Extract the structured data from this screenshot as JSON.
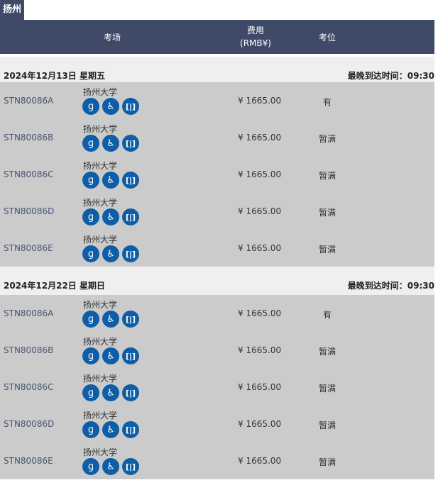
{
  "city_tab": "扬州",
  "header": {
    "venue": "考场",
    "fee_line1": "费用",
    "fee_line2": "(RMB¥)",
    "seat": "考位"
  },
  "icons": [
    "hearing-aid-icon",
    "wheelchair-icon",
    "accessible-door-icon"
  ],
  "colors": {
    "header_bg": "#3f4a68",
    "row_bg": "#cbcbcb",
    "date_bg": "#efefef",
    "icon_bg": "#0d5ea6",
    "code_text": "#4a5577"
  },
  "groups": [
    {
      "date": "2024年12月13日 星期五",
      "latest_arrival": "最晚到达时间：09:30",
      "rows": [
        {
          "code": "STN80086A",
          "venue": "扬州大学",
          "price": "¥ 1665.00",
          "seat": "有"
        },
        {
          "code": "STN80086B",
          "venue": "扬州大学",
          "price": "¥ 1665.00",
          "seat": "暂满"
        },
        {
          "code": "STN80086C",
          "venue": "扬州大学",
          "price": "¥ 1665.00",
          "seat": "暂满"
        },
        {
          "code": "STN80086D",
          "venue": "扬州大学",
          "price": "¥ 1665.00",
          "seat": "暂满"
        },
        {
          "code": "STN80086E",
          "venue": "扬州大学",
          "price": "¥ 1665.00",
          "seat": "暂满"
        }
      ]
    },
    {
      "date": "2024年12月22日 星期日",
      "latest_arrival": "最晚到达时间：09:30",
      "rows": [
        {
          "code": "STN80086A",
          "venue": "扬州大学",
          "price": "¥ 1665.00",
          "seat": "有"
        },
        {
          "code": "STN80086B",
          "venue": "扬州大学",
          "price": "¥ 1665.00",
          "seat": "暂满"
        },
        {
          "code": "STN80086C",
          "venue": "扬州大学",
          "price": "¥ 1665.00",
          "seat": "暂满"
        },
        {
          "code": "STN80086D",
          "venue": "扬州大学",
          "price": "¥ 1665.00",
          "seat": "暂满"
        },
        {
          "code": "STN80086E",
          "venue": "扬州大学",
          "price": "¥ 1665.00",
          "seat": "暂满"
        }
      ]
    }
  ]
}
